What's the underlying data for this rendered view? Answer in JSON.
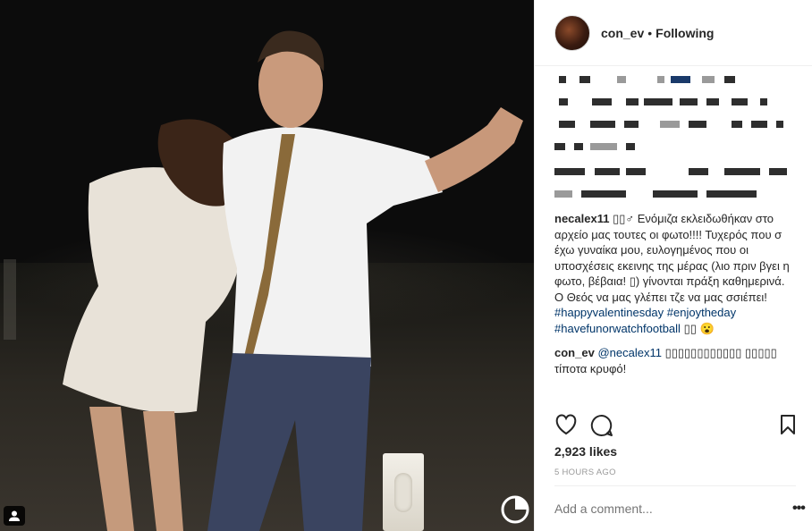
{
  "header": {
    "username": "con_ev",
    "separator": "•",
    "follow_status": "Following"
  },
  "comments": [
    {
      "username": "necalex11",
      "text": "▯▯♂ Ενόμιζα εκλειδωθήκαν στο αρχείο μας τουτες οι φωτο!!!! Τυχερός που σ έχω γυναίκα μου, ευλογημένος που οι υποσχέσεις εκεινης της μέρας (λιο πριν βγει η φωτο, βέβαια! ▯) γίνονται πράξη καθημερινά. Ο Θεός να μας γλέπει τζε να μας σσιέπει!",
      "hashtags": [
        "#happyvalentinesday",
        "#enjoytheday",
        "#havefunorwatchfootball"
      ],
      "tail": "▯▯ 😮"
    },
    {
      "username": "con_ev",
      "mention": "@necalex11",
      "text": "▯▯▯▯▯▯▯▯▯▯▯▯ ▯▯▯▯▯ τίποτα κρυφό!"
    }
  ],
  "likes": "2,923 likes",
  "time_ago": "5 HOURS AGO",
  "add_comment_placeholder": "Add a comment...",
  "more_label": "•••",
  "icons": {
    "like": "heart-icon",
    "comment": "comment-icon",
    "save": "bookmark-icon",
    "tag": "person-tag-icon"
  }
}
